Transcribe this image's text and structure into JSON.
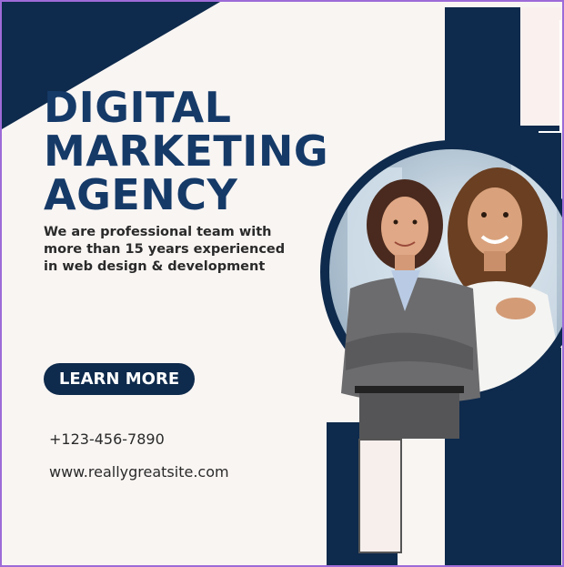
{
  "poster": {
    "headline_line1": "DIGITAL",
    "headline_line2": "MARKETING",
    "headline_line3": "AGENCY",
    "subtext_line1": "We are professional team with",
    "subtext_line2": "more than 15 years experienced",
    "subtext_line3": "in web design & development",
    "cta_label": "LEARN MORE",
    "phone": "+123-456-7890",
    "website": "www.reallygreatsite.com",
    "photo_icon": "two-women-photo"
  },
  "colors": {
    "navy": "#0e2a4c",
    "headline": "#153a68",
    "background": "#f9f5f3",
    "frame": "#9d6bd8"
  }
}
